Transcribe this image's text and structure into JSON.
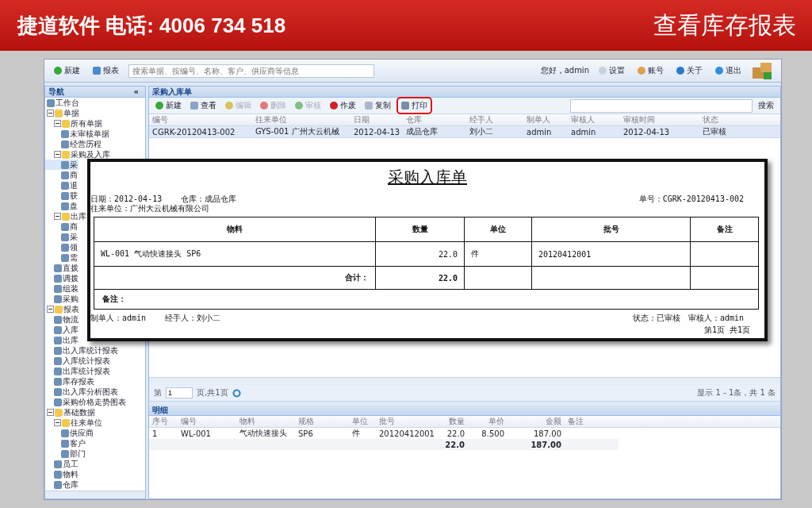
{
  "slide_header": {
    "left": "捷道软件 电话: 4006 734 518",
    "right": "查看库存报表"
  },
  "top_toolbar": {
    "buttons": [
      "新建",
      "报表"
    ],
    "search": {
      "placeholder": "搜索单据、按编号、名称、客户、供应商等信息"
    },
    "greeting": "您好，admin",
    "links": [
      "设置",
      "账号",
      "关于",
      "退出"
    ]
  },
  "nav": {
    "title": "导航",
    "collapse": "«",
    "tree": [
      {
        "label": "工作台",
        "kind": "page"
      },
      {
        "label": "单据",
        "kind": "folder",
        "expanded": true,
        "children": [
          {
            "label": "所有单据",
            "kind": "folder",
            "expanded": true,
            "children": [
              {
                "label": "未审核单据",
                "kind": "page"
              },
              {
                "label": "经营历程",
                "kind": "page"
              }
            ]
          },
          {
            "label": "采购及入库",
            "kind": "folder",
            "expanded": true,
            "children": [
              {
                "label": "采",
                "kind": "page",
                "selected": true
              },
              {
                "label": "商",
                "kind": "page",
                "selected": false
              },
              {
                "label": "退",
                "kind": "page",
                "selected": false
              },
              {
                "label": "获",
                "kind": "page",
                "selected": false
              },
              {
                "label": "盘",
                "kind": "page",
                "selected": false
              }
            ]
          },
          {
            "label": "出库",
            "kind": "folder",
            "expanded": true,
            "children": [
              {
                "label": "商",
                "kind": "page"
              },
              {
                "label": "采",
                "kind": "page"
              },
              {
                "label": "领",
                "kind": "page"
              },
              {
                "label": "需",
                "kind": "page"
              }
            ]
          },
          {
            "label": "直拨",
            "kind": "page"
          },
          {
            "label": "调拨",
            "kind": "page"
          },
          {
            "label": "组装",
            "kind": "page"
          },
          {
            "label": "采购",
            "kind": "page"
          }
        ]
      },
      {
        "label": "报表",
        "kind": "folder",
        "expanded": true,
        "children": [
          {
            "label": "物流",
            "kind": "page"
          },
          {
            "label": "入库",
            "kind": "page"
          },
          {
            "label": "出库",
            "kind": "page"
          },
          {
            "label": "出入库统计报表",
            "kind": "page"
          },
          {
            "label": "入库统计报表",
            "kind": "page"
          },
          {
            "label": "出库统计报表",
            "kind": "page"
          },
          {
            "label": "库存报表",
            "kind": "page"
          },
          {
            "label": "出入库分析图表",
            "kind": "page"
          },
          {
            "label": "采购价格走势图表",
            "kind": "page"
          }
        ]
      },
      {
        "label": "基础数据",
        "kind": "folder",
        "expanded": true,
        "children": [
          {
            "label": "往来单位",
            "kind": "folder",
            "expanded": true,
            "children": [
              {
                "label": "供应商",
                "kind": "page"
              },
              {
                "label": "客户",
                "kind": "page"
              },
              {
                "label": "部门",
                "kind": "page"
              }
            ]
          },
          {
            "label": "员工",
            "kind": "page"
          },
          {
            "label": "物料",
            "kind": "page"
          },
          {
            "label": "仓库",
            "kind": "page"
          }
        ]
      }
    ]
  },
  "grid": {
    "title": "采购入库单",
    "toolbar": [
      {
        "label": "新建",
        "disabled": false
      },
      {
        "label": "查看",
        "disabled": false
      },
      {
        "label": "编辑",
        "disabled": true
      },
      {
        "label": "删除",
        "disabled": true
      },
      {
        "label": "审核",
        "disabled": true
      },
      {
        "label": "作废",
        "disabled": false
      },
      {
        "label": "复制",
        "disabled": false
      },
      {
        "label": "打印",
        "disabled": false,
        "highlighted": true
      }
    ],
    "search_button": "搜索",
    "columns": [
      "编号",
      "往来单位",
      "日期",
      "仓库",
      "经手人",
      "制单人",
      "审核人",
      "审核时间",
      "状态"
    ],
    "rows": [
      {
        "selected": true,
        "cells": [
          "CGRK-20120413-002",
          "GYS-001 广州大云机械",
          "2012-04-13",
          "成品仓库",
          "刘小二",
          "admin",
          "admin",
          "2012-04-13",
          "已审核"
        ]
      }
    ]
  },
  "pager": {
    "page_label": "第",
    "page": "1",
    "total": "页,共1页",
    "summary": "显示 1 - 1条，共 1 条"
  },
  "detail": {
    "title": "明细",
    "columns": [
      "序号",
      "编号",
      "物料",
      "规格",
      "单位",
      "批号",
      "数量",
      "单价",
      "金额",
      "备注"
    ],
    "rows": [
      [
        "1",
        "WL-001",
        "气动快速接头",
        "SP6",
        "件",
        "20120412001",
        "22.0",
        "8.500",
        "187.00"
      ]
    ],
    "totals": {
      "quantity": "22.0",
      "amount": "187.00"
    }
  },
  "print_preview": {
    "title": "采购入库单",
    "date": "日期：2012-04-13",
    "warehouse": "仓库：成品仓库",
    "number": "单号：CGRK-20120413-002",
    "partner": "往来单位：广州大云机械有限公司",
    "columns": [
      "物料",
      "数量",
      "单位",
      "批号",
      "备注"
    ],
    "rows": [
      [
        "WL-001 气动快速接头 SP6",
        "22.0",
        "件",
        "20120412001"
      ]
    ],
    "total_label": "合计：",
    "total_quantity": "22.0",
    "remark_label": "备注：",
    "maker": "制单人：admin",
    "handler": "经手人：刘小二",
    "status": "状态：已审核",
    "auditor": "审核人：admin",
    "page": "第1页 共1页"
  }
}
